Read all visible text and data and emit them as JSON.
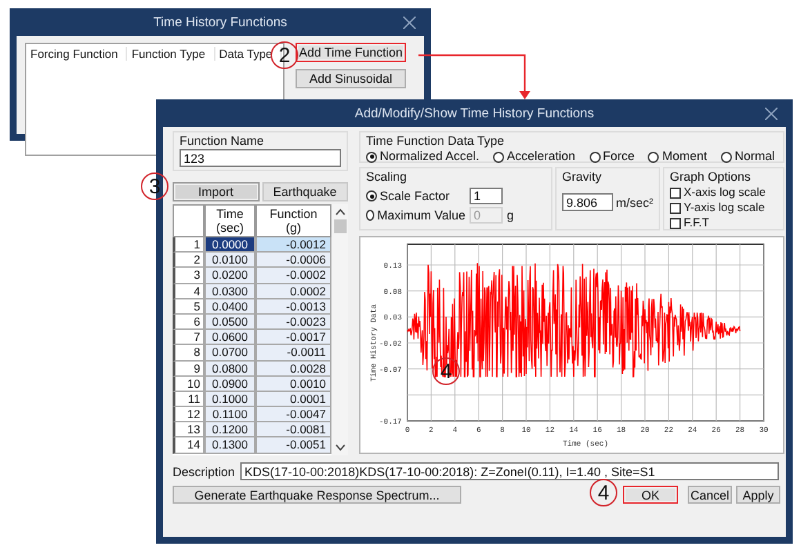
{
  "back_window": {
    "title": "Time History Functions",
    "list_columns": [
      "Forcing Function",
      "Function Type",
      "Data Type"
    ],
    "buttons": [
      {
        "label": "Add Time Function",
        "highlighted": true
      },
      {
        "label": "Add Sinusoidal",
        "highlighted": false
      }
    ]
  },
  "dialog": {
    "title": "Add/Modify/Show Time History Functions",
    "function_name": {
      "label": "Function Name",
      "value": "123"
    },
    "tabs": [
      {
        "label": "Import",
        "selected": true,
        "highlighted": true
      },
      {
        "label": "Earthquake",
        "selected": false,
        "highlighted": false
      }
    ],
    "table": {
      "columns": [
        {
          "title": "Time",
          "unit": "(sec)"
        },
        {
          "title": "Function",
          "unit": "(g)"
        }
      ],
      "rows": [
        {
          "index": "1",
          "time": "0.0000",
          "value": "-0.0012",
          "selected": true
        },
        {
          "index": "2",
          "time": "0.0100",
          "value": "-0.0006",
          "selected": false
        },
        {
          "index": "3",
          "time": "0.0200",
          "value": "-0.0002",
          "selected": false
        },
        {
          "index": "4",
          "time": "0.0300",
          "value": "0.0002",
          "selected": false
        },
        {
          "index": "5",
          "time": "0.0400",
          "value": "-0.0013",
          "selected": false
        },
        {
          "index": "6",
          "time": "0.0500",
          "value": "-0.0023",
          "selected": false
        },
        {
          "index": "7",
          "time": "0.0600",
          "value": "-0.0017",
          "selected": false
        },
        {
          "index": "8",
          "time": "0.0700",
          "value": "-0.0011",
          "selected": false
        },
        {
          "index": "9",
          "time": "0.0800",
          "value": "0.0028",
          "selected": false
        },
        {
          "index": "10",
          "time": "0.0900",
          "value": "0.0010",
          "selected": false
        },
        {
          "index": "11",
          "time": "0.1000",
          "value": "0.0001",
          "selected": false
        },
        {
          "index": "12",
          "time": "0.1100",
          "value": "-0.0047",
          "selected": false
        },
        {
          "index": "13",
          "time": "0.1200",
          "value": "-0.0081",
          "selected": false
        },
        {
          "index": "14",
          "time": "0.1300",
          "value": "-0.0051",
          "selected": false
        }
      ]
    },
    "data_type": {
      "label": "Time Function Data Type",
      "options": [
        {
          "label": "Normalized Accel.",
          "selected": true
        },
        {
          "label": "Acceleration",
          "selected": false
        },
        {
          "label": "Force",
          "selected": false
        },
        {
          "label": "Moment",
          "selected": false
        },
        {
          "label": "Normal",
          "selected": false
        }
      ]
    },
    "scaling": {
      "label": "Scaling",
      "options": [
        {
          "label": "Scale Factor",
          "selected": true,
          "value": "1",
          "disabled": false
        },
        {
          "label": "Maximum Value",
          "selected": false,
          "value": "0",
          "disabled": true,
          "unit": "g"
        }
      ]
    },
    "gravity": {
      "label": "Gravity",
      "value": "9.806",
      "unit": "m/sec²"
    },
    "graph_options": {
      "label": "Graph Options",
      "options": [
        {
          "label": "X-axis log scale",
          "checked": false
        },
        {
          "label": "Y-axis log scale",
          "checked": false
        },
        {
          "label": "F.F.T",
          "checked": false
        }
      ]
    },
    "chart": {
      "ylabel": "Time History Data",
      "xlabel": "Time (sec)",
      "yticks": [
        "0.13",
        "0.08",
        "0.03",
        "-0.02",
        "-0.07",
        "-0.17"
      ],
      "xticks": [
        "0",
        "2",
        "4",
        "6",
        "8",
        "10",
        "12",
        "14",
        "16",
        "18",
        "20",
        "22",
        "24",
        "26",
        "28",
        "30"
      ]
    },
    "description": {
      "label": "Description",
      "value": "KDS(17-10-00:2018)KDS(17-10-00:2018): Z=ZoneI(0.11), I=1.40 , Site=S1"
    },
    "buttons": [
      {
        "label": "Generate Earthquake Response Spectrum...",
        "kind": "wide",
        "highlighted": false
      },
      {
        "label": "OK",
        "kind": "normal",
        "highlighted": true
      },
      {
        "label": "Cancel",
        "kind": "normal",
        "highlighted": false
      },
      {
        "label": "Apply",
        "kind": "normal",
        "highlighted": false
      }
    ]
  },
  "callouts": [
    {
      "label": "2"
    },
    {
      "label": "3"
    },
    {
      "label": "4"
    },
    {
      "label": "4"
    }
  ]
}
